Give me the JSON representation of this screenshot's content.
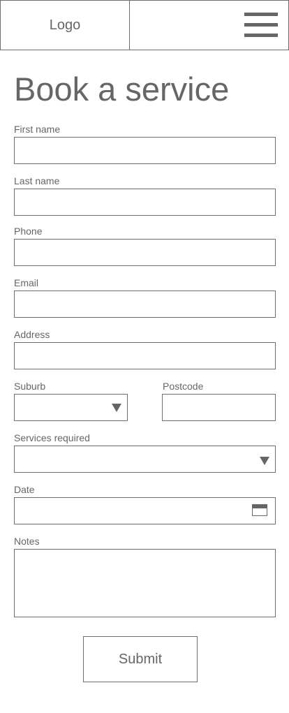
{
  "header": {
    "logo_text": "Logo",
    "menu_icon": "hamburger-menu-icon"
  },
  "page": {
    "title": "Book a service"
  },
  "form": {
    "first_name": {
      "label": "First name",
      "value": "",
      "placeholder": ""
    },
    "last_name": {
      "label": "Last name",
      "value": "",
      "placeholder": ""
    },
    "phone": {
      "label": "Phone",
      "value": "",
      "placeholder": ""
    },
    "email": {
      "label": "Email",
      "value": "",
      "placeholder": ""
    },
    "address": {
      "label": "Address",
      "value": "",
      "placeholder": ""
    },
    "suburb": {
      "label": "Suburb",
      "selected": "",
      "icon": "dropdown-triangle-icon"
    },
    "postcode": {
      "label": "Postcode",
      "value": "",
      "placeholder": ""
    },
    "services": {
      "label": "Services required",
      "selected": "",
      "icon": "dropdown-triangle-icon"
    },
    "date": {
      "label": "Date",
      "value": "",
      "icon": "calendar-icon"
    },
    "notes": {
      "label": "Notes",
      "value": ""
    },
    "submit_label": "Submit"
  },
  "colors": {
    "text": "#666666",
    "border": "#6e6e6e",
    "background": "#ffffff"
  }
}
